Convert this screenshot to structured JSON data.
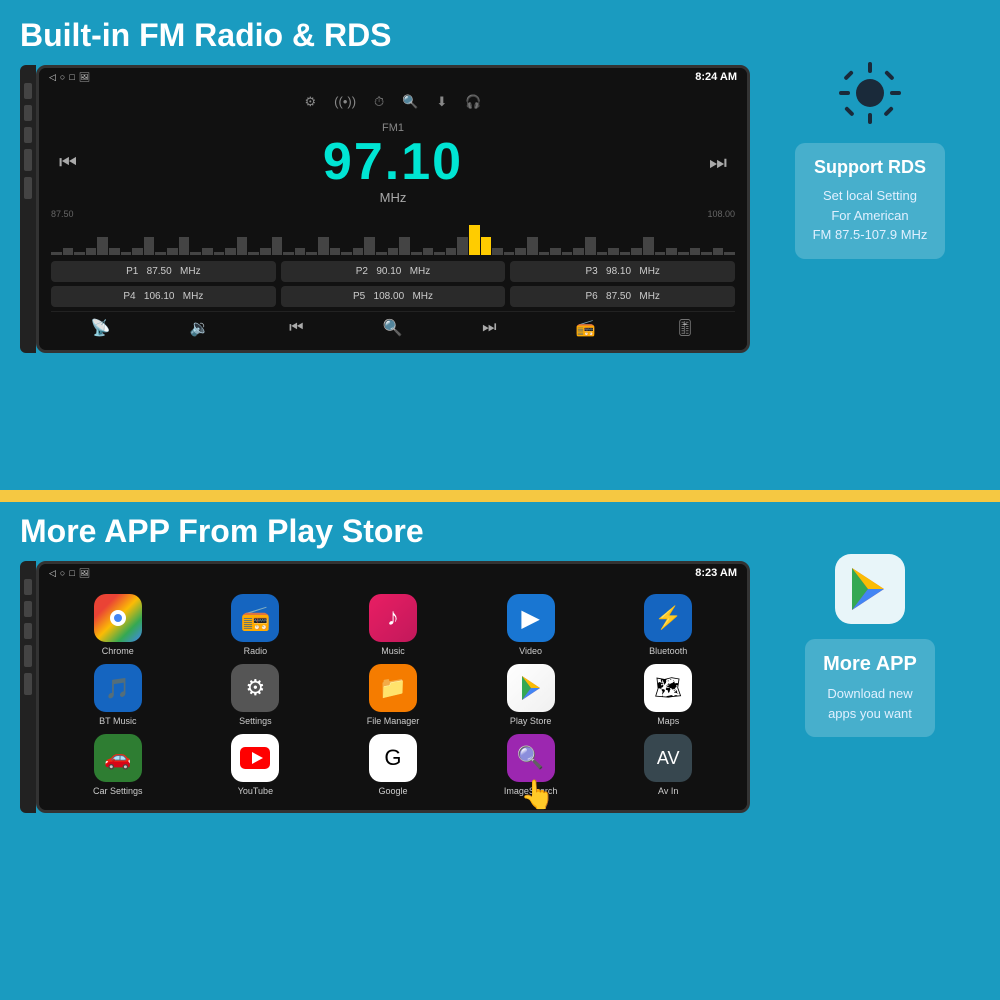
{
  "top": {
    "title": "Built-in FM Radio & RDS",
    "device": {
      "statusBar": {
        "time": "8:24 AM",
        "icons": "✦ ♥ ▽"
      },
      "fm": {
        "label": "FM1",
        "frequency": "97.10",
        "unit": "MHz",
        "spectrumLeft": "87.50",
        "spectrumRight": "108.00",
        "presets": [
          {
            "id": "P1",
            "freq": "87.50",
            "unit": "MHz"
          },
          {
            "id": "P2",
            "freq": "90.10",
            "unit": "MHz"
          },
          {
            "id": "P3",
            "freq": "98.10",
            "unit": "MHz"
          },
          {
            "id": "P4",
            "freq": "106.10",
            "unit": "MHz"
          },
          {
            "id": "P5",
            "freq": "108.00",
            "unit": "MHz"
          },
          {
            "id": "P6",
            "freq": "87.50",
            "unit": "MHz"
          }
        ]
      }
    },
    "rds": {
      "title": "Support RDS",
      "desc": "Set local Setting\nFor American\nFM 87.5-107.9 MHz"
    }
  },
  "bottom": {
    "title": "More APP From Play Store",
    "device": {
      "statusBar": {
        "time": "8:23 AM"
      },
      "apps": [
        {
          "label": "Chrome",
          "icon": "chrome"
        },
        {
          "label": "Radio",
          "icon": "radio"
        },
        {
          "label": "Music",
          "icon": "music"
        },
        {
          "label": "Video",
          "icon": "video"
        },
        {
          "label": "Bluetooth",
          "icon": "bluetooth"
        },
        {
          "label": "BT Music",
          "icon": "btmusic"
        },
        {
          "label": "Settings",
          "icon": "settings"
        },
        {
          "label": "File Manager",
          "icon": "files"
        },
        {
          "label": "Play Store",
          "icon": "playstore"
        },
        {
          "label": "Maps",
          "icon": "maps"
        },
        {
          "label": "Car Settings",
          "icon": "carsettings"
        },
        {
          "label": "YouTube",
          "icon": "youtube"
        },
        {
          "label": "Google",
          "icon": "google"
        },
        {
          "label": "ImageSearch",
          "icon": "imagesearch"
        },
        {
          "label": "Av In",
          "icon": "avin"
        }
      ]
    },
    "moreapp": {
      "title": "More APP",
      "desc": "Download new\napps you want"
    }
  }
}
